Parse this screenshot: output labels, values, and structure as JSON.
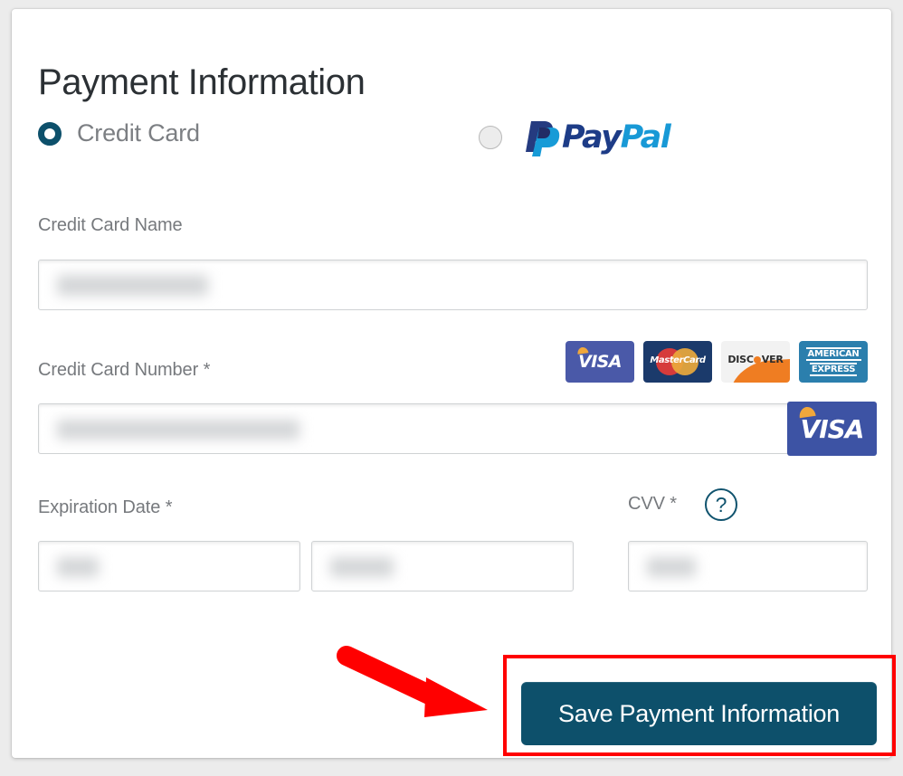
{
  "page": {
    "title": "Payment Information",
    "background_color": "#ececec",
    "panel_color": "#ffffff",
    "accent_color": "#0d506b",
    "annotation_color": "#ff0000"
  },
  "payment_methods": {
    "selected": "credit-card",
    "options": [
      {
        "id": "credit-card",
        "label": "Credit Card",
        "selected": true
      },
      {
        "id": "paypal",
        "label": "PayPal",
        "selected": false
      }
    ],
    "paypal_logo": {
      "word_one": "Pay",
      "word_two": "Pal",
      "color_one": "#1d3c87",
      "color_two": "#1899d6",
      "monogram": "paypal-p-monogram"
    }
  },
  "fields": {
    "card_name": {
      "label": "Credit Card Name",
      "value": "",
      "placeholder": "",
      "redacted": true,
      "required": false
    },
    "card_number": {
      "label": "Credit Card Number *",
      "value": "",
      "placeholder": "",
      "redacted": true,
      "required": true,
      "detected_brand": "VISA"
    },
    "expiration": {
      "label": "Expiration Date *",
      "required": true,
      "month": {
        "value": "",
        "redacted": true
      },
      "year": {
        "value": "",
        "redacted": true
      }
    },
    "cvv": {
      "label": "CVV *",
      "value": "",
      "redacted": true,
      "required": true,
      "help_icon": "question-mark-icon",
      "help_glyph": "?"
    }
  },
  "accepted_cards": [
    {
      "id": "visa",
      "name": "VISA",
      "background": "#4a59a8",
      "text_color": "#ffffff"
    },
    {
      "id": "mastercard",
      "name": "MasterCard",
      "background": "#1b3a6b",
      "text_color": "#ffffff"
    },
    {
      "id": "discover",
      "name": "DISCOVER",
      "background": "#f2f2f2",
      "text_color": "#2b2b2b"
    },
    {
      "id": "amex",
      "name_line_one": "AMERICAN",
      "name_line_two": "EXPRESS",
      "background": "#2b7fad",
      "text_color": "#ffffff"
    }
  ],
  "actions": {
    "save_label": "Save Payment Information"
  },
  "annotations": {
    "highlight_target": "save-payment-information-button",
    "arrow": "red-arrow-pointing-right"
  }
}
